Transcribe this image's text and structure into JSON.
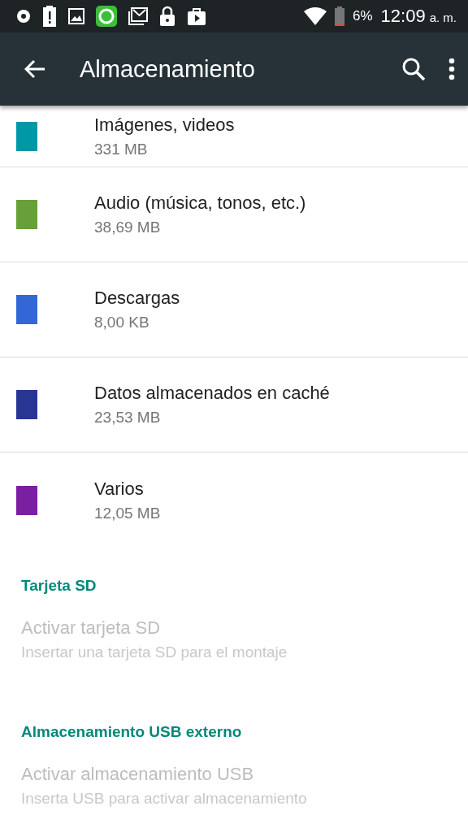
{
  "status_bar": {
    "battery": "6%",
    "time": "12:09",
    "ampm": "a. m."
  },
  "app_bar": {
    "title": "Almacenamiento"
  },
  "storage_items": [
    {
      "title": "Imágenes, videos",
      "size": "331 MB",
      "color": "#0097a7"
    },
    {
      "title": "Audio (música, tonos, etc.)",
      "size": "38,69 MB",
      "color": "#689f38"
    },
    {
      "title": "Descargas",
      "size": "8,00 KB",
      "color": "#3367d6"
    },
    {
      "title": "Datos almacenados en caché",
      "size": "23,53 MB",
      "color": "#283593"
    },
    {
      "title": "Varios",
      "size": "12,05 MB",
      "color": "#7b1fa2"
    }
  ],
  "sections": [
    {
      "header": "Tarjeta SD",
      "items": [
        {
          "title": "Activar tarjeta SD",
          "summary": "Insertar una tarjeta SD para el montaje",
          "disabled": true
        }
      ]
    },
    {
      "header": "Almacenamiento USB externo",
      "items": [
        {
          "title": "Activar almacenamiento USB",
          "summary": "Inserta USB para activar almacenamiento",
          "disabled": true
        }
      ]
    }
  ]
}
